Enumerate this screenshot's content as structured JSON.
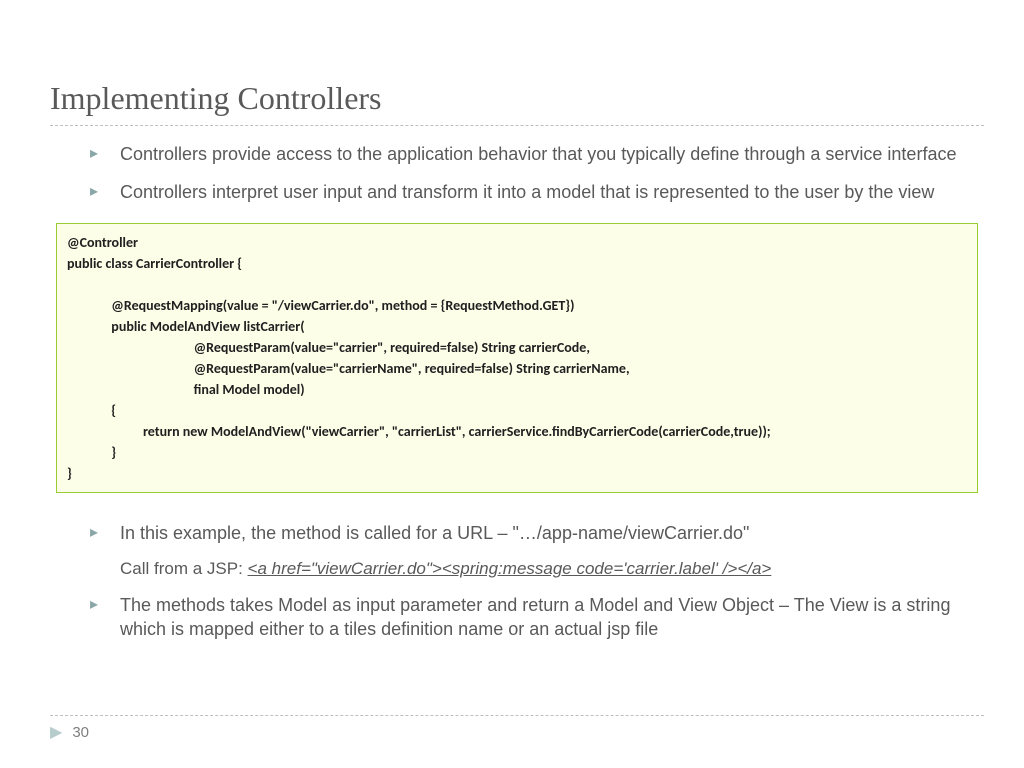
{
  "title": "Implementing Controllers",
  "bullets_top": [
    "Controllers provide access to the application behavior that you typically define through a service interface",
    "Controllers interpret user input and transform it into a model that is represented to the user by the view"
  ],
  "code": {
    "l0": "@Controller",
    "l1": "public class CarrierController {",
    "l2": "",
    "l3": "              @RequestMapping(value = \"/viewCarrier.do\", method = {RequestMethod.GET})",
    "l4": "              public ModelAndView listCarrier(",
    "l5": "                                        @RequestParam(value=\"carrier\", required=false) String carrierCode,",
    "l6": "                                        @RequestParam(value=\"carrierName\", required=false) String carrierName,",
    "l7": "                                        final Model model)",
    "l8": "              {",
    "l9": "                        return new ModelAndView(\"viewCarrier\", \"carrierList\", carrierService.findByCarrierCode(carrierCode,true));",
    "l10": "              }",
    "l11": "}"
  },
  "bullets_bottom": {
    "b0": "In this example, the method is called for a URL – \"…/app-name/viewCarrier.do\"",
    "sub_prefix": "Call from a JSP:  ",
    "sub_link": "<a href=\"viewCarrier.do\"><spring:message code='carrier.label' /></a>",
    "b1": "The methods takes Model as input parameter and return a Model and View Object – The View is a string which is mapped either to a tiles definition name or an actual jsp file"
  },
  "page_number": "30"
}
